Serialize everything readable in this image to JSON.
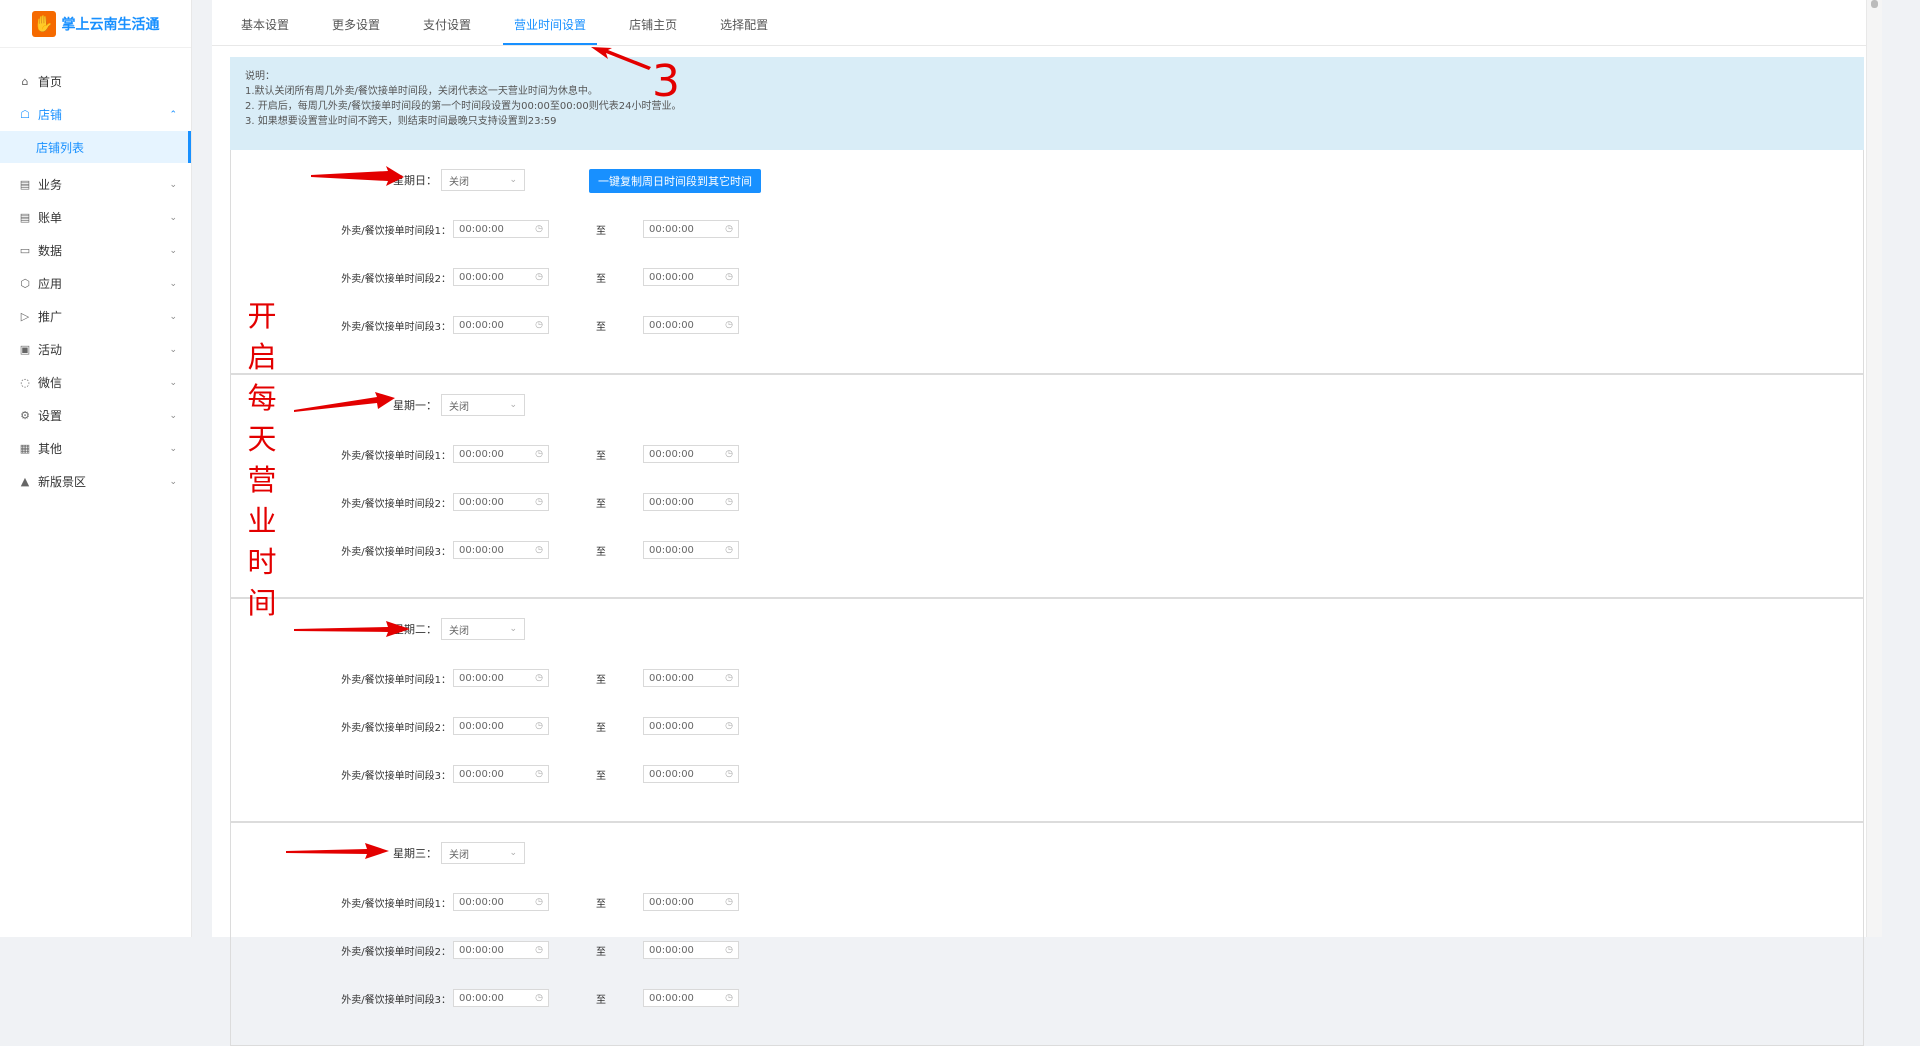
{
  "brand": {
    "name": "掌上云南生活通",
    "logo_glyph": "✋"
  },
  "sidebar": {
    "items": [
      {
        "label": "首页",
        "icon": "home-icon",
        "glyph": "⌂",
        "arrow": ""
      },
      {
        "label": "店铺",
        "icon": "store-icon",
        "glyph": "☖",
        "arrow": "⌃"
      },
      {
        "label": "业务",
        "icon": "business-icon",
        "glyph": "▤",
        "arrow": "⌄"
      },
      {
        "label": "账单",
        "icon": "bill-icon",
        "glyph": "▤",
        "arrow": "⌄"
      },
      {
        "label": "数据",
        "icon": "monitor-icon",
        "glyph": "▭",
        "arrow": "⌄"
      },
      {
        "label": "应用",
        "icon": "app-icon",
        "glyph": "⬡",
        "arrow": "⌄"
      },
      {
        "label": "推广",
        "icon": "megaphone-icon",
        "glyph": "▷",
        "arrow": "⌄"
      },
      {
        "label": "活动",
        "icon": "activity-icon",
        "glyph": "▣",
        "arrow": "⌄"
      },
      {
        "label": "微信",
        "icon": "wechat-icon",
        "glyph": "◌",
        "arrow": "⌄"
      },
      {
        "label": "设置",
        "icon": "gear-icon",
        "glyph": "⚙",
        "arrow": "⌄"
      },
      {
        "label": "其他",
        "icon": "grid-icon",
        "glyph": "▦",
        "arrow": "⌄"
      },
      {
        "label": "新版景区",
        "icon": "scenic-icon",
        "glyph": "▲",
        "arrow": "⌄"
      }
    ],
    "active_submenu": "店铺列表"
  },
  "tabs": [
    "基本设置",
    "更多设置",
    "支付设置",
    "营业时间设置",
    "店铺主页",
    "选择配置"
  ],
  "active_tab": "营业时间设置",
  "notice": {
    "title": "说明：",
    "lines": [
      "1.默认关闭所有周几外卖/餐饮接单时间段，关闭代表这一天营业时间为休息中。",
      "2. 开启后，每周几外卖/餐饮接单时间段的第一个时间段设置为00:00至00:00则代表24小时营业。",
      "3. 如果想要设置营业时间不跨天，则结束时间最晚只支持设置到23:59"
    ]
  },
  "copy_button": "一键复制周日时间段到其它时间",
  "days": [
    {
      "label": "星期日：",
      "status": "关闭"
    },
    {
      "label": "星期一：",
      "status": "关闭"
    },
    {
      "label": "星期二：",
      "status": "关闭"
    },
    {
      "label": "星期三：",
      "status": "关闭"
    }
  ],
  "slot_labels": [
    "外卖/餐饮接单时间段1：",
    "外卖/餐饮接单时间段2：",
    "外卖/餐饮接单时间段3："
  ],
  "to_label": "至",
  "time_value": "00:00:00",
  "annotation": {
    "step_number": "3",
    "vertical_text": [
      "开",
      "启",
      "每",
      "天",
      "营",
      "业",
      "时",
      "间"
    ],
    "color": "#e30000"
  },
  "colors": {
    "accent": "#1890ff",
    "notice_bg": "#d9edf7",
    "logo": "#f56a00"
  }
}
